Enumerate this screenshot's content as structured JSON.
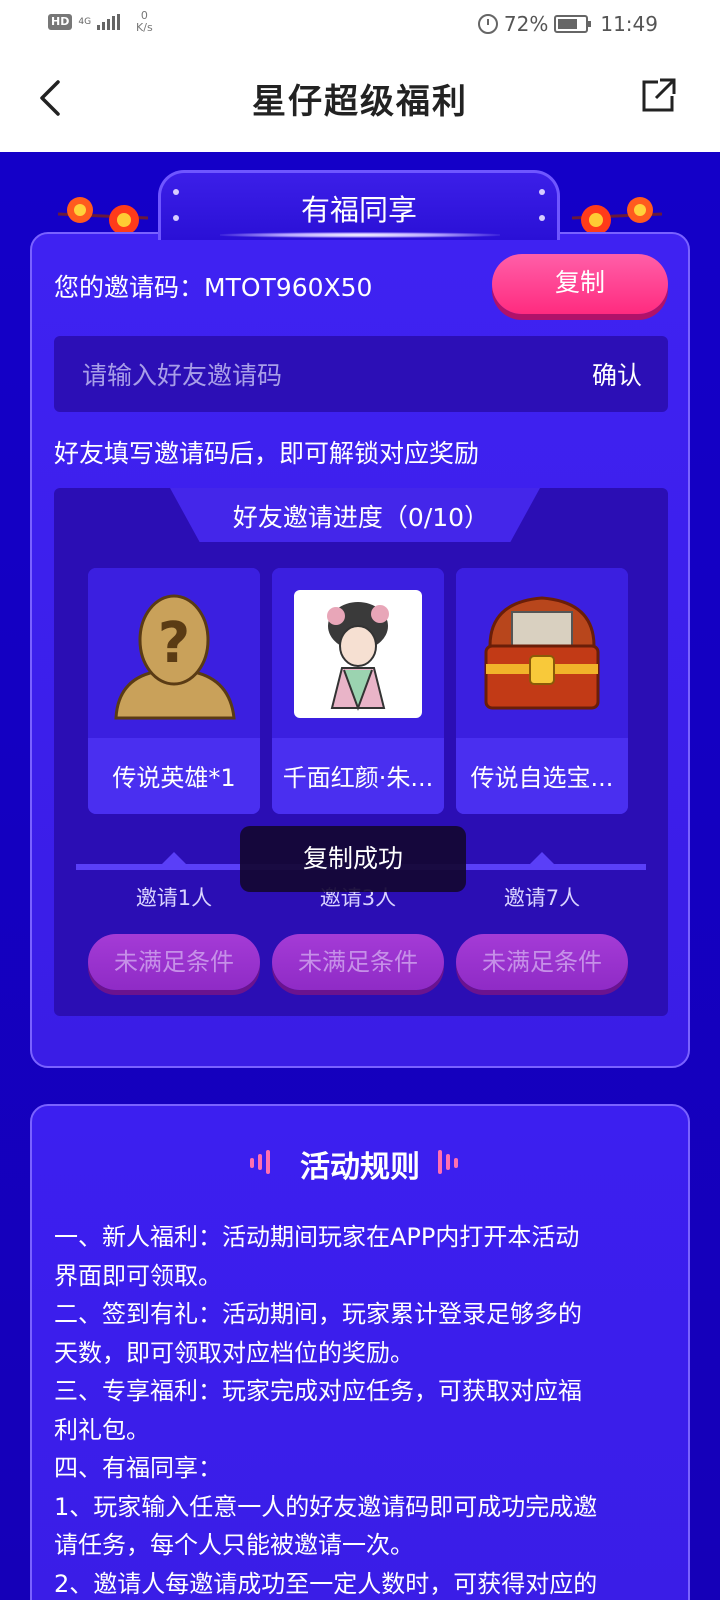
{
  "status_bar": {
    "hd": "HD",
    "network": "4G",
    "speed_value": "0",
    "speed_unit": "K/s",
    "battery": "72%",
    "time": "11:49"
  },
  "header": {
    "title": "星仔超级福利"
  },
  "share": {
    "banner_title": "有福同享",
    "code_label": "您的邀请码：MTOT960X50",
    "copy_label": "复制",
    "input_placeholder": "请输入好友邀请码",
    "confirm_label": "确认",
    "hint": "好友填写邀请码后，即可解锁对应奖励",
    "progress_title": "好友邀请进度（0/10）",
    "rewards": [
      {
        "name": "传说英雄*1",
        "milestone": "邀请1人",
        "button": "未满足条件"
      },
      {
        "name": "千面红颜·朱...",
        "milestone": "邀请3人",
        "button": "未满足条件"
      },
      {
        "name": "传说自选宝...",
        "milestone": "邀请7人",
        "button": "未满足条件"
      }
    ]
  },
  "toast": {
    "text": "复制成功"
  },
  "rules": {
    "title": "活动规则",
    "lines": [
      "一、新人福利：活动期间玩家在APP内打开本活动",
      "界面即可领取。",
      "二、签到有礼：活动期间，玩家累计登录足够多的",
      "天数，即可领取对应档位的奖励。",
      "三、专享福利：玩家完成对应任务，可获取对应福",
      "利礼包。",
      "四、有福同享：",
      "1、玩家输入任意一人的好友邀请码即可成功完成邀",
      "请任务，每个人只能被邀请一次。",
      "2、邀请人每邀请成功至一定人数时，可获得对应的"
    ]
  },
  "colors": {
    "page_bg": "#1400c8",
    "card_bg": "#3f22f2",
    "accent_pink": "#ff2b7f",
    "disabled_button": "#a43bd6"
  }
}
